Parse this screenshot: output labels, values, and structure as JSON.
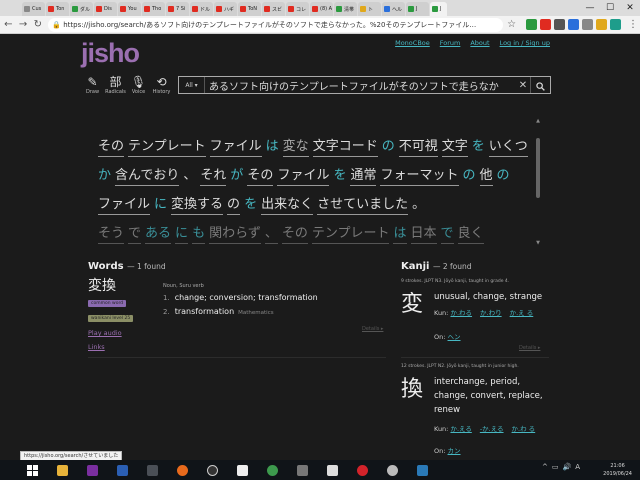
{
  "browser": {
    "tabs": [
      {
        "label": "Cus",
        "color": "gray"
      },
      {
        "label": "Ton",
        "color": "red"
      },
      {
        "label": "ダル",
        "color": "green"
      },
      {
        "label": "Dis",
        "color": "red"
      },
      {
        "label": "You",
        "color": "red"
      },
      {
        "label": "Tho",
        "color": "red"
      },
      {
        "label": "7 Si",
        "color": "red"
      },
      {
        "label": "ドル",
        "color": "red"
      },
      {
        "label": "ハギ",
        "color": "red"
      },
      {
        "label": "ToN",
        "color": "red"
      },
      {
        "label": "スビ",
        "color": "red"
      },
      {
        "label": "コレ",
        "color": "red"
      },
      {
        "label": "(8) A",
        "color": "red"
      },
      {
        "label": "清帯",
        "color": "green"
      },
      {
        "label": "ト",
        "color": "yellow"
      },
      {
        "label": "ヘル",
        "color": "blue"
      },
      {
        "label": "J",
        "color": "green"
      }
    ],
    "active_tab_label": "J",
    "url": "https://jisho.org/search/あるソフト向けのテンプレートファイルがそのソフトで走らなかった。%20そのテンプレートファイル…",
    "window_controls": {
      "minimize": "—",
      "maximize": "☐",
      "close": "✕"
    }
  },
  "site": {
    "logo": "jisho",
    "toplinks": [
      "MonoCBoe",
      "Forum",
      "About",
      "Log in / Sign up"
    ],
    "tools": [
      {
        "label": "Draw",
        "icon": "✎",
        "name": "draw-icon"
      },
      {
        "label": "Radicals",
        "icon": "部",
        "name": "radicals-icon"
      },
      {
        "label": "Voice",
        "icon": "🎙",
        "name": "microphone-icon"
      },
      {
        "label": "History",
        "icon": "⟲",
        "name": "history-icon"
      }
    ],
    "search": {
      "filter": "All",
      "value": "あるソフト向けのテンプレートファイルがそのソフトで走らなか",
      "clear": "✕",
      "button": "🔍"
    }
  },
  "sentence": {
    "line1": [
      {
        "t": "その",
        "k": "w"
      },
      {
        "t": "テンプレート",
        "k": "w"
      },
      {
        "t": "ファイル",
        "k": "w"
      },
      {
        "t": "は",
        "k": "p"
      },
      {
        "t": "変な",
        "k": "h"
      },
      {
        "t": "文字コード",
        "k": "w"
      },
      {
        "t": "の",
        "k": "p"
      },
      {
        "t": "不可視",
        "k": "w"
      },
      {
        "t": "文字",
        "k": "w"
      },
      {
        "t": "を",
        "k": "p"
      },
      {
        "t": "いくつ",
        "k": "w"
      }
    ],
    "line2": [
      {
        "t": "か",
        "k": "p"
      },
      {
        "t": "含んでおり",
        "k": "w"
      },
      {
        "t": "、",
        "k": "n"
      },
      {
        "t": "それ",
        "k": "w"
      },
      {
        "t": "が",
        "k": "p"
      },
      {
        "t": "その",
        "k": "w"
      },
      {
        "t": "ファイル",
        "k": "w"
      },
      {
        "t": "を",
        "k": "p"
      },
      {
        "t": "通常",
        "k": "w"
      },
      {
        "t": "フォーマット",
        "k": "w"
      },
      {
        "t": "の",
        "k": "p"
      },
      {
        "t": "他",
        "k": "w"
      },
      {
        "t": "の",
        "k": "p"
      }
    ],
    "line3": [
      {
        "t": "ファイル",
        "k": "w"
      },
      {
        "t": "に",
        "k": "p"
      },
      {
        "t": "変換する",
        "k": "w"
      },
      {
        "t": "の",
        "k": "w"
      },
      {
        "t": "を",
        "k": "p"
      },
      {
        "t": "出来なく",
        "k": "w"
      },
      {
        "t": "させていました",
        "k": "w"
      },
      {
        "t": "。",
        "k": "n"
      }
    ],
    "line4": [
      {
        "t": "そう",
        "k": "w"
      },
      {
        "t": "で",
        "k": "n"
      },
      {
        "t": "ある",
        "k": "p"
      },
      {
        "t": "に",
        "k": "p"
      },
      {
        "t": "も",
        "k": "p"
      },
      {
        "t": "関わらず",
        "k": "w"
      },
      {
        "t": "、",
        "k": "n"
      },
      {
        "t": "その",
        "k": "w"
      },
      {
        "t": "テンプレート",
        "k": "w"
      },
      {
        "t": "は",
        "k": "p"
      },
      {
        "t": "日本",
        "k": "w"
      },
      {
        "t": "で",
        "k": "p"
      },
      {
        "t": "良く",
        "k": "w"
      }
    ]
  },
  "words": {
    "heading": "Words",
    "count": "— 1 found",
    "word": "変換",
    "tags": [
      "common word",
      "wanikani level 25"
    ],
    "links": [
      "Play audio",
      "Links"
    ],
    "pos": "Noun, Suru verb",
    "senses": [
      {
        "num": "1.",
        "text": "change; conversion; transformation",
        "cat": ""
      },
      {
        "num": "2.",
        "text": "transformation",
        "cat": "Mathematics"
      }
    ],
    "details": "Details ▸"
  },
  "kanji": {
    "heading": "Kanji",
    "count": "— 2 found",
    "items": [
      {
        "meta": "9 strokes. JLPT N3. Jōyō kanji, taught in grade 4.",
        "char": "変",
        "meanings": "unusual, change, strange",
        "kun_label": "Kun:",
        "kun": [
          "か.わる",
          "か.わり",
          "か.え る"
        ],
        "on_label": "On:",
        "on": [
          "ヘン"
        ],
        "details": "Details ▸"
      },
      {
        "meta": "12 strokes. JLPT N2. Jōyō kanji, taught in junior high.",
        "char": "換",
        "meanings": "interchange, period, change, convert, replace, renew",
        "kun_label": "Kun:",
        "kun": [
          "か.える",
          "-か.える",
          "か.わ る"
        ],
        "on_label": "On:",
        "on": [
          "カン"
        ]
      }
    ]
  },
  "status_bar": "https://jisho.org/search/させていました",
  "taskbar": {
    "time": "21:06",
    "date": "2019/06/24",
    "tray": [
      "^",
      "▭",
      "🔊",
      "A"
    ]
  }
}
